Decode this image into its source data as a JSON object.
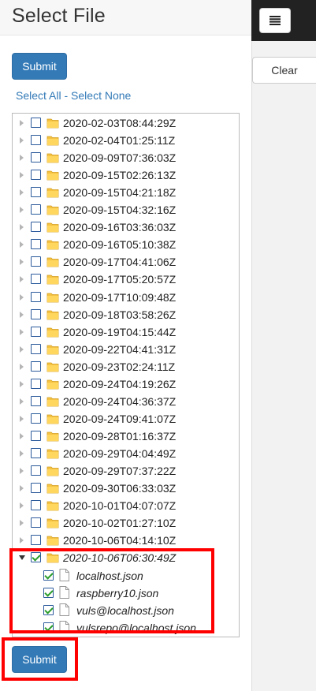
{
  "header": {
    "title": "Select File"
  },
  "buttons": {
    "submit_top": "Submit",
    "submit_bottom": "Submit",
    "clear": "Clear",
    "menu_icon": "hamburger-menu-icon"
  },
  "select_links": {
    "all": "Select All",
    "separator": " - ",
    "none": "Select None"
  },
  "tree": {
    "folders": [
      "2020-02-03T08:44:29Z",
      "2020-02-04T01:25:11Z",
      "2020-09-09T07:36:03Z",
      "2020-09-15T02:26:13Z",
      "2020-09-15T04:21:18Z",
      "2020-09-15T04:32:16Z",
      "2020-09-16T03:36:03Z",
      "2020-09-16T05:10:38Z",
      "2020-09-17T04:41:06Z",
      "2020-09-17T05:20:57Z",
      "2020-09-17T10:09:48Z",
      "2020-09-18T03:58:26Z",
      "2020-09-19T04:15:44Z",
      "2020-09-22T04:41:31Z",
      "2020-09-23T02:24:11Z",
      "2020-09-24T04:19:26Z",
      "2020-09-24T04:36:37Z",
      "2020-09-24T09:41:07Z",
      "2020-09-28T01:16:37Z",
      "2020-09-29T04:04:49Z",
      "2020-09-29T07:37:22Z",
      "2020-09-30T06:33:03Z",
      "2020-10-01T04:07:07Z",
      "2020-10-02T01:27:10Z",
      "2020-10-06T04:14:10Z"
    ],
    "expanded_folder": {
      "name": "2020-10-06T06:30:49Z",
      "checked": true,
      "files": [
        "localhost.json",
        "raspberry10.json",
        "vuls@localhost.json",
        "vulsrepo@localhost.json"
      ]
    }
  },
  "colors": {
    "primary": "#337ab7",
    "highlight": "#ff0000",
    "folder": "#f5c242",
    "check": "#2a9d2a"
  }
}
